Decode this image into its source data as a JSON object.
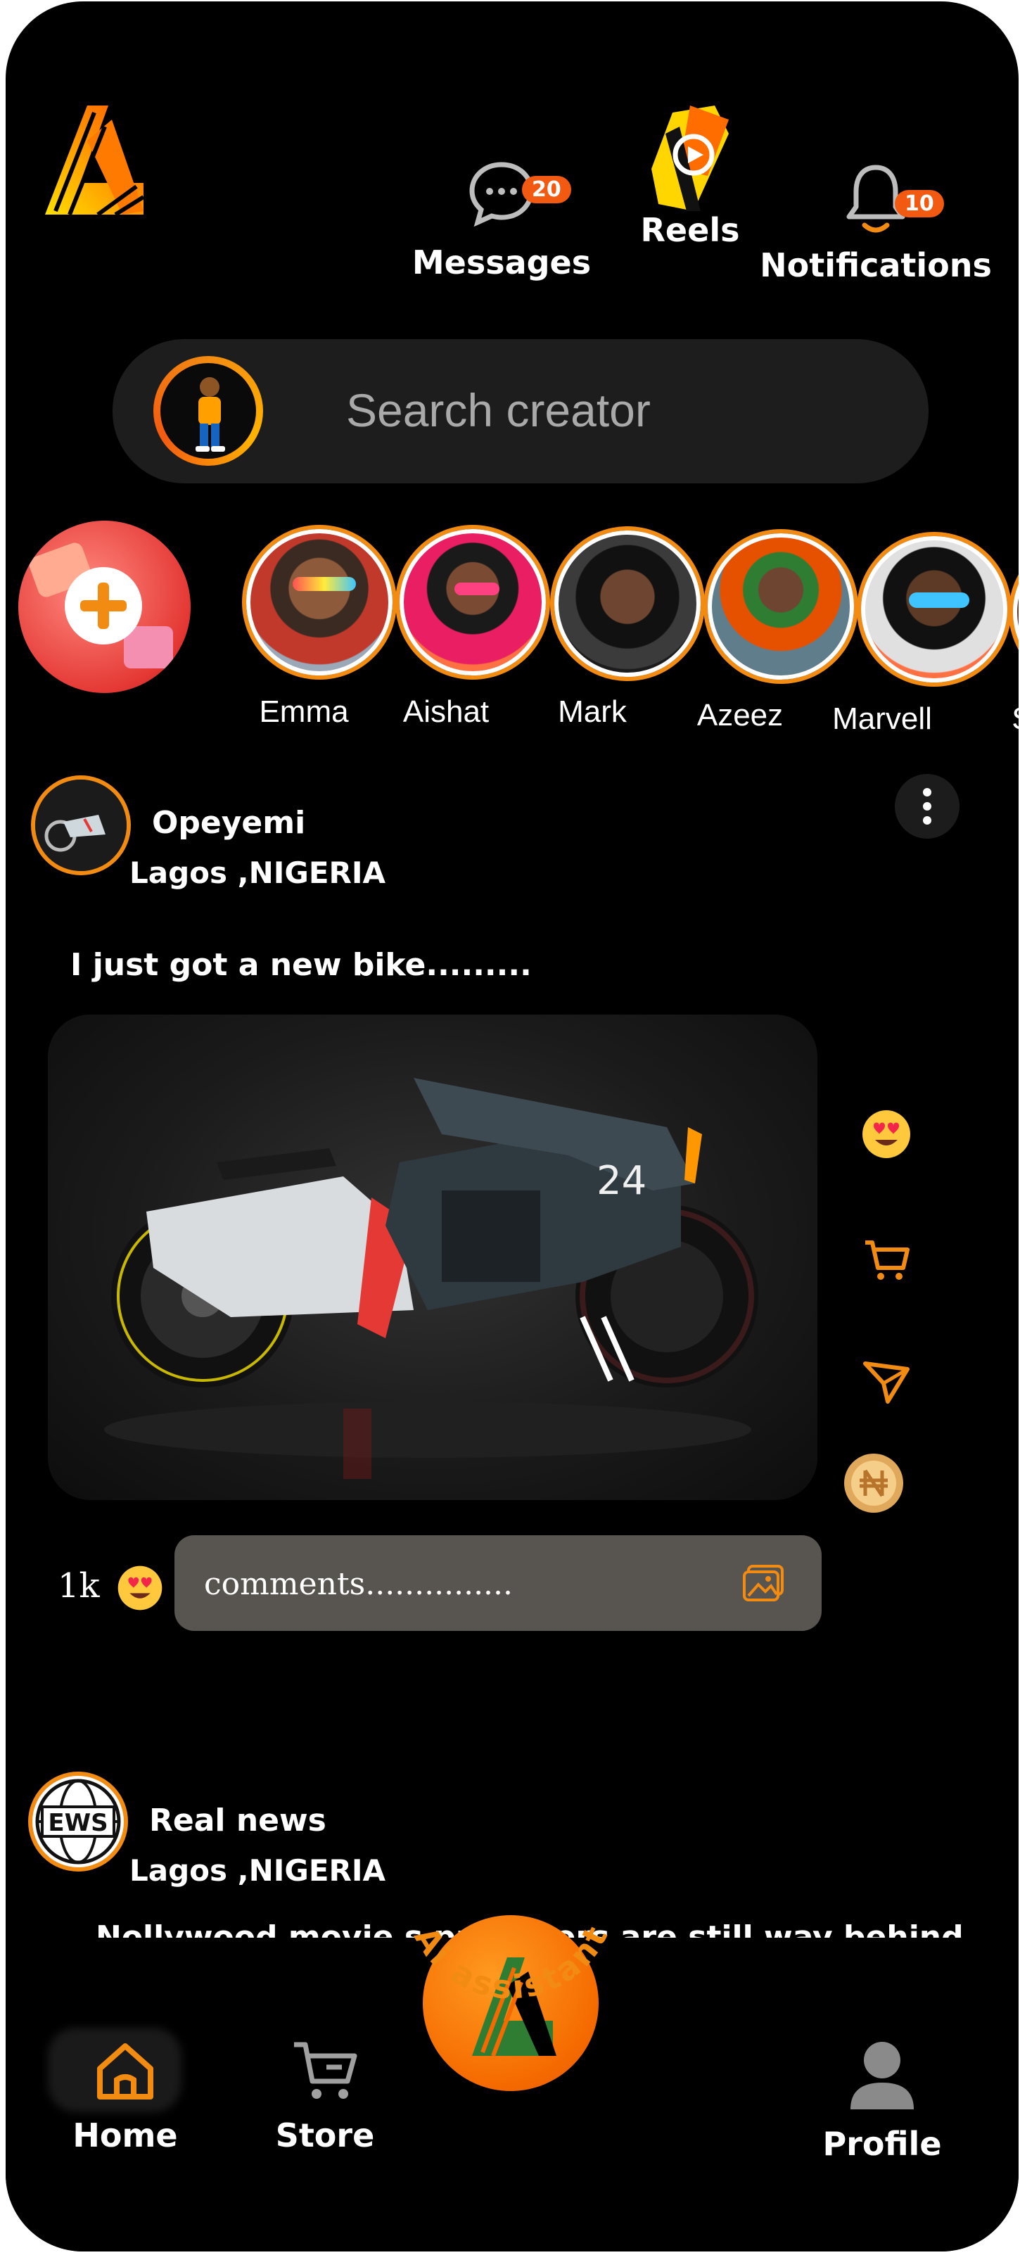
{
  "header": {
    "messages": {
      "label": "Messages",
      "badge": "20"
    },
    "reels": {
      "label": "Reels"
    },
    "notifications": {
      "label": "Notifications",
      "badge": "10"
    }
  },
  "search": {
    "placeholder": "Search creator"
  },
  "stories": [
    {
      "name": "Emma"
    },
    {
      "name": "Aishat"
    },
    {
      "name": "Mark"
    },
    {
      "name": "Azeez"
    },
    {
      "name": "Marvell"
    },
    {
      "name": "Sid"
    }
  ],
  "posts": [
    {
      "author": "Opeyemi",
      "location": "Lagos ,NIGERIA",
      "text": "I just got a new bike.........",
      "image_text": "24",
      "like_count": "1k",
      "comment_placeholder": "comments..............."
    },
    {
      "author": "Real news",
      "avatar_text": "EWS",
      "location": "Lagos ,NIGERIA",
      "text": "Nollywood movie s producers are still way behind"
    }
  ],
  "ai_assistant": {
    "label": "Ai assistant"
  },
  "bottom_nav": {
    "home": "Home",
    "store": "Store",
    "profile": "Profile"
  },
  "colors": {
    "accent": "#f28b12",
    "badge": "#f25a12",
    "background": "#000000",
    "comment_box": "#58544f"
  }
}
